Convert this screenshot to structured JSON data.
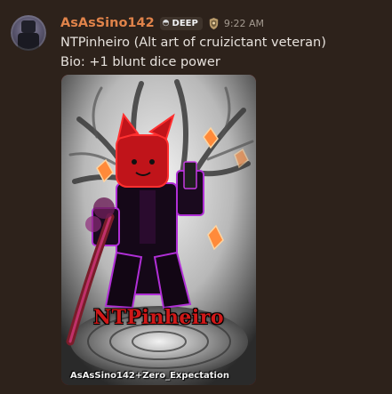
{
  "message": {
    "username": "AsAsSino142",
    "tag": {
      "icon": "clan-tag-icon",
      "label": "DEEP"
    },
    "badge_icon": "crest-badge-icon",
    "timestamp": "9:22 AM",
    "lines": [
      "NTPinheiro (Alt art of cruizictant veteran)",
      "Bio: +1 blunt dice power"
    ],
    "attachment": {
      "art_title": "NTPinheiro",
      "credit": "AsAsSino142+Zero_Expectation",
      "border_color": "#c01414"
    }
  },
  "colors": {
    "background": "#2d221b",
    "username": "#e0834a",
    "text": "#e6e1dc",
    "accent_red": "#c01414",
    "accent_purple": "#b02fd6"
  }
}
